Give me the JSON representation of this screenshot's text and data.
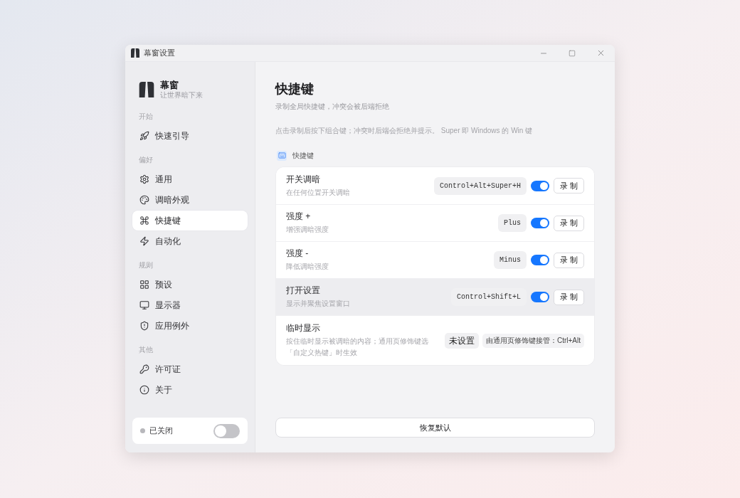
{
  "window": {
    "title": "幕窗设置"
  },
  "sidebar": {
    "brand": {
      "name": "幕窗",
      "tagline": "让世界暗下来"
    },
    "sections": [
      {
        "label": "开始",
        "items": [
          {
            "label": "快速引导",
            "selected": false
          }
        ]
      },
      {
        "label": "偏好",
        "items": [
          {
            "label": "通用",
            "selected": false
          },
          {
            "label": "调暗外观",
            "selected": false
          },
          {
            "label": "快捷键",
            "selected": true
          },
          {
            "label": "自动化",
            "selected": false
          }
        ]
      },
      {
        "label": "规则",
        "items": [
          {
            "label": "预设",
            "selected": false
          },
          {
            "label": "显示器",
            "selected": false
          },
          {
            "label": "应用例外",
            "selected": false
          }
        ]
      },
      {
        "label": "其他",
        "items": [
          {
            "label": "许可证",
            "selected": false
          },
          {
            "label": "关于",
            "selected": false
          }
        ]
      }
    ],
    "status": {
      "label": "已关闭",
      "on": false
    }
  },
  "page": {
    "title": "快捷键",
    "subtitle": "录制全局快捷键，冲突会被后端拒绝",
    "hint": "点击录制后按下组合键；冲突时后端会拒绝并提示。 Super 即 Windows 的 Win 键"
  },
  "group": {
    "label": "快捷键"
  },
  "shortcuts": [
    {
      "kind": "recordable",
      "title": "开关调暗",
      "description": "在任何位置开关调暗",
      "keys": "Control+Alt+Super+H",
      "enabled": true,
      "record_label": "录 制",
      "highlighted": false
    },
    {
      "kind": "recordable",
      "title": "强度 +",
      "description": "增强调暗强度",
      "keys": "Plus",
      "enabled": true,
      "record_label": "录 制",
      "highlighted": false
    },
    {
      "kind": "recordable",
      "title": "强度 -",
      "description": "降低调暗强度",
      "keys": "Minus",
      "enabled": true,
      "record_label": "录 制",
      "highlighted": false
    },
    {
      "kind": "recordable",
      "title": "打开设置",
      "description": "显示并聚焦设置窗口",
      "keys": "Control+Shift+L",
      "enabled": true,
      "record_label": "录 制",
      "highlighted": true
    },
    {
      "kind": "modifier",
      "title": "临时显示",
      "description": "按住临时显示被调暗的内容；通用页修饰键选「自定义热键」时生效",
      "keys": "未设置",
      "note": "由通用页修饰键接管：Ctrl+Alt",
      "highlighted": false
    }
  ],
  "reset_button": "恢复默认"
}
